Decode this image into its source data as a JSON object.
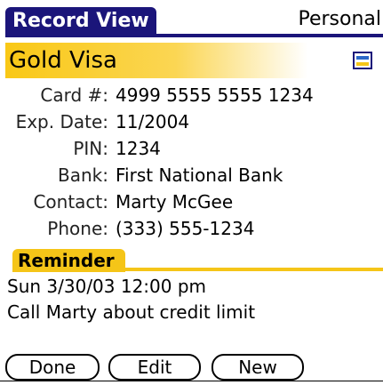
{
  "title_bar": {
    "title": "Record View",
    "category": "Personal"
  },
  "record": {
    "name": "Gold Visa",
    "note_icon": "note-icon"
  },
  "fields": [
    {
      "label": "Card #:",
      "value": "4999 5555 5555 1234"
    },
    {
      "label": "Exp. Date:",
      "value": "11/2004"
    },
    {
      "label": "PIN:",
      "value": "1234"
    },
    {
      "label": "Bank:",
      "value": "First National Bank"
    },
    {
      "label": "Contact:",
      "value": "Marty McGee"
    },
    {
      "label": "Phone:",
      "value": "(333) 555-1234"
    }
  ],
  "reminder": {
    "title": "Reminder",
    "datetime": "Sun 3/30/03 12:00 pm",
    "note": "Call Marty about credit limit"
  },
  "buttons": {
    "done": "Done",
    "edit": "Edit",
    "new": "New"
  },
  "colors": {
    "title_bar": "#1b157a",
    "accent_yellow": "#f5c518"
  }
}
